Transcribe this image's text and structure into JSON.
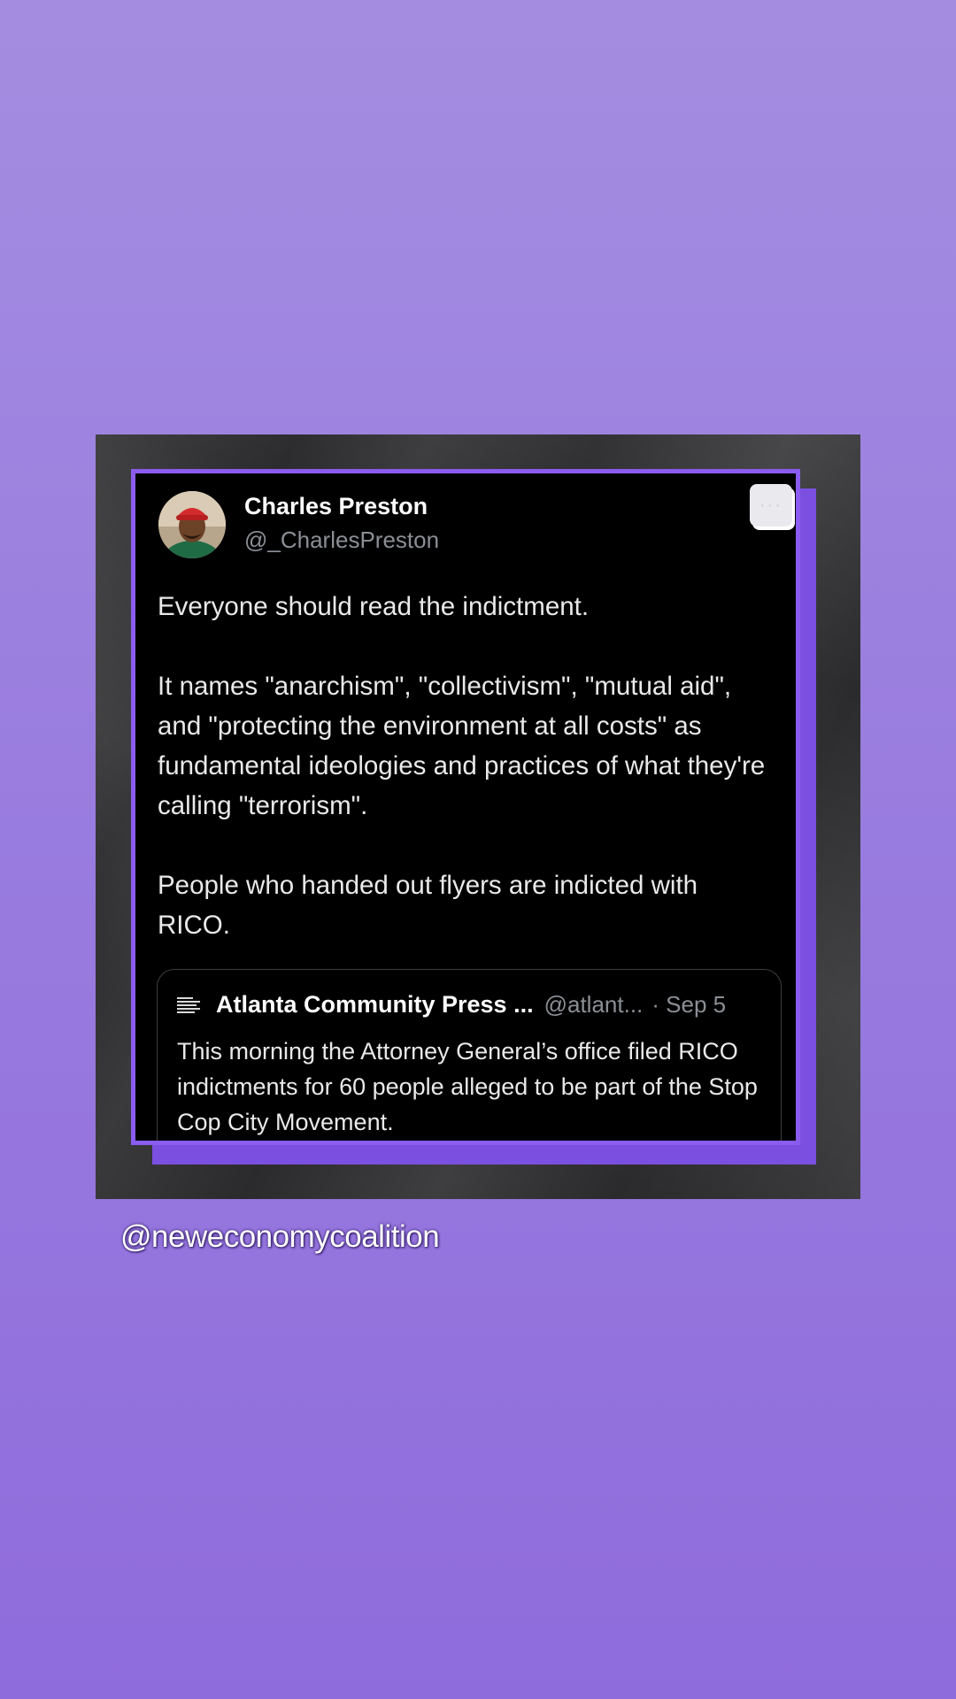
{
  "tweet": {
    "author_name": "Charles Preston",
    "author_handle": "@_CharlesPreston",
    "paragraphs": [
      "Everyone should read the indictment.",
      "It names \"anarchism\", \"collectivism\", \"mutual aid\", and \"protecting the environment at all costs\" as fundamental ideologies and practices of what they're calling \"terrorism\".",
      "People who handed out flyers are indicted with RICO."
    ],
    "more_icon": "ellipsis-icon"
  },
  "quoted_tweet": {
    "author_name": "Atlanta Community Press ...",
    "author_handle": "@atlant...",
    "date": "· Sep 5",
    "text": "This morning the Attorney General’s office filed RICO indictments for 60 people alleged to be part of the Stop Cop City Movement."
  },
  "watermark": "@neweconomycoalition",
  "colors": {
    "background": "#9a7ddf",
    "card_border": "#8a5cf0",
    "card_bg": "#000000",
    "secondary_text": "#8b8f95"
  }
}
